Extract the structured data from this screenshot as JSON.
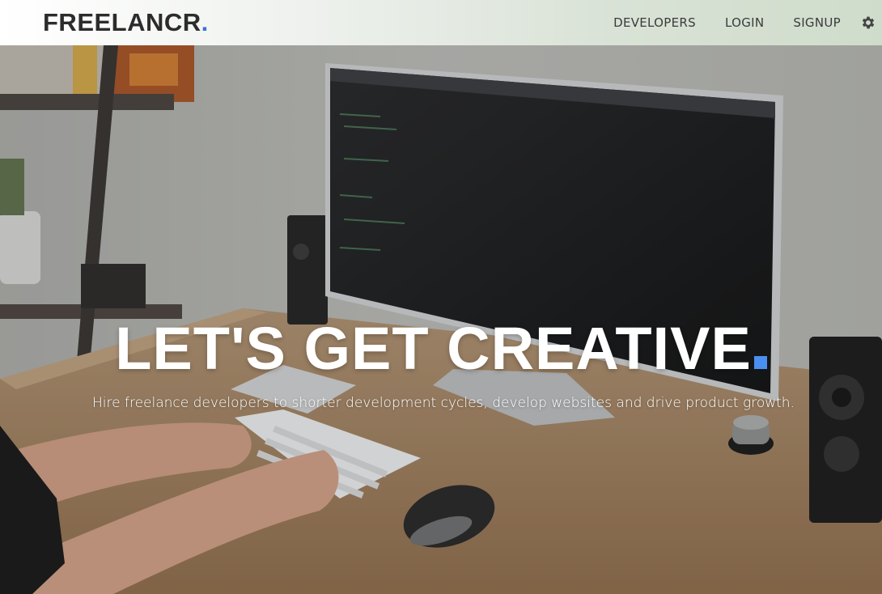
{
  "navbar": {
    "brand": "FREELANCR",
    "brand_dot": ".",
    "links": [
      {
        "label": "DEVELOPERS"
      },
      {
        "label": "LOGIN"
      },
      {
        "label": "SIGNUP"
      }
    ],
    "settings_icon": "gear-icon"
  },
  "hero": {
    "title": "LET'S GET CREATIVE",
    "subtitle": "Hire freelance developers to shorter development cycles, develop websites and drive product growth.",
    "background_image": "workspace photo: person typing at desk with large monitor, speakers and mouse",
    "accent_color": "#4a8ff0"
  },
  "colors": {
    "brand_text": "#2c2c2c",
    "brand_dot": "#3e6fd8",
    "nav_text": "#3b3b3b"
  }
}
